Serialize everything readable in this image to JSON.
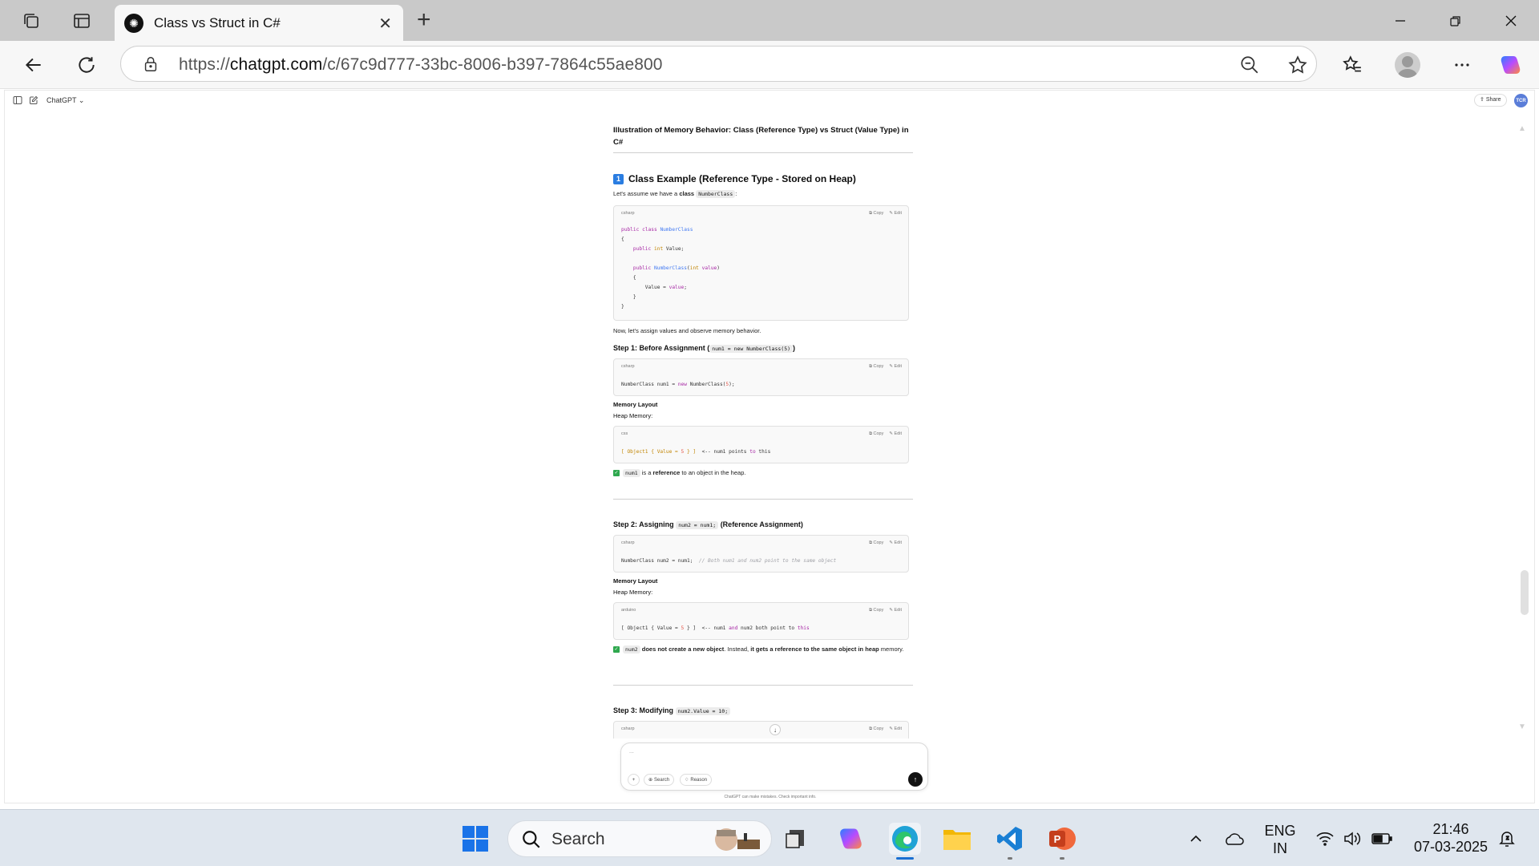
{
  "browser": {
    "tab_title": "Class vs Struct in C#",
    "url_prefix": "https://",
    "url_domain": "chatgpt.com",
    "url_path": "/c/67c9d777-33bc-8006-b397-7864c55ae800"
  },
  "chat": {
    "model_label": "ChatGPT",
    "share_label": "Share",
    "avatar_initials": "TCR",
    "composer_placeholder": "...",
    "search_button": "Search",
    "reason_button": "Reason",
    "footnote": "ChatGPT can make mistakes. Check important info."
  },
  "content": {
    "main_heading": "Illustration of Memory Behavior: Class (Reference Type) vs Struct (Value Type) in C#",
    "section1_badge": "1",
    "section1_title": "Class Example (Reference Type - Stored on Heap)",
    "intro_text": "Let's assume we have a",
    "intro_bold": "class",
    "intro_code": "NumberClass",
    "intro_end": ":",
    "after_code_text": "Now, let's assign values and observe memory behavior.",
    "step1_title": "Step 1: Before Assignment (",
    "step1_code": "num1 = new NumberClass(5)",
    "step1_end": ")",
    "memory_layout": "Memory Layout",
    "heap_memory": "Heap Memory:",
    "step1_note_code": "num1",
    "step1_note_a": "is a",
    "step1_note_bold": "reference",
    "step1_note_b": "to an object in the heap.",
    "step2_title": "Step 2: Assigning",
    "step2_code": "num2 = num1;",
    "step2_end": "(Reference Assignment)",
    "step2_note_code": "num2",
    "step2_note_bold1": "does not create a new object",
    "step2_note_a": ". Instead,",
    "step2_note_bold2": "it gets a reference to the same object in heap",
    "step2_note_b": "memory",
    "step3_title": "Step 3: Modifying",
    "step3_code": "num2.Value = 10;",
    "copy_label": "Copy",
    "edit_label": "Edit"
  },
  "code_blocks": [
    {
      "lang": "csharp"
    },
    {
      "lang": "csharp"
    },
    {
      "lang": "css"
    },
    {
      "lang": "csharp"
    },
    {
      "lang": "arduino"
    },
    {
      "lang": "csharp"
    }
  ],
  "taskbar": {
    "search_label": "Search",
    "lang_line1": "ENG",
    "lang_line2": "IN",
    "time": "21:46",
    "date": "07-03-2025"
  }
}
